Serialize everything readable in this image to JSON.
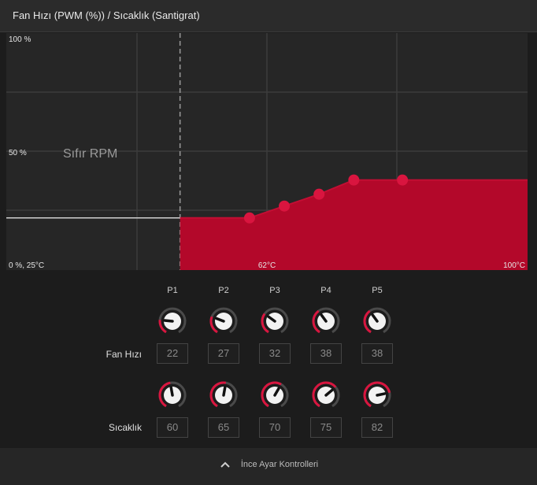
{
  "header": {
    "title": "Fan Hızı (PWM (%)) / Sıcaklık (Santigrat)"
  },
  "chart_data": {
    "type": "area",
    "title": "",
    "y_tick_labels": {
      "top": "100 %",
      "middle": "50 %",
      "origin": "0 %, 25°C"
    },
    "x_tick_labels": {
      "mid": "62°C",
      "max": "100°C"
    },
    "zero_rpm_label": "Sıfır RPM",
    "xlim": [
      25,
      100
    ],
    "ylim": [
      0,
      100
    ],
    "zero_rpm_until": 50,
    "zero_rpm_fan": 22,
    "series": [
      {
        "points": [
          {
            "x": 50,
            "y": 22
          },
          {
            "x": 60,
            "y": 22
          },
          {
            "x": 65,
            "y": 27
          },
          {
            "x": 70,
            "y": 32
          },
          {
            "x": 75,
            "y": 38
          },
          {
            "x": 82,
            "y": 38
          },
          {
            "x": 100,
            "y": 38
          }
        ]
      }
    ],
    "grid": true,
    "color": "#b3082a",
    "point_color": "#d9153f"
  },
  "points": {
    "labels": [
      "P1",
      "P2",
      "P3",
      "P4",
      "P5"
    ],
    "fan_label": "Fan Hızı",
    "temp_label": "Sıcaklık",
    "fan_values": [
      "22",
      "27",
      "32",
      "38",
      "38"
    ],
    "temp_values": [
      "60",
      "65",
      "70",
      "75",
      "82"
    ]
  },
  "footer": {
    "label": "İnce Ayar Kontrolleri",
    "icon": "chevron-up-icon"
  },
  "colors": {
    "accent": "#d9153f",
    "fill": "#b3082a",
    "knob_track": "#4a4a4a"
  }
}
